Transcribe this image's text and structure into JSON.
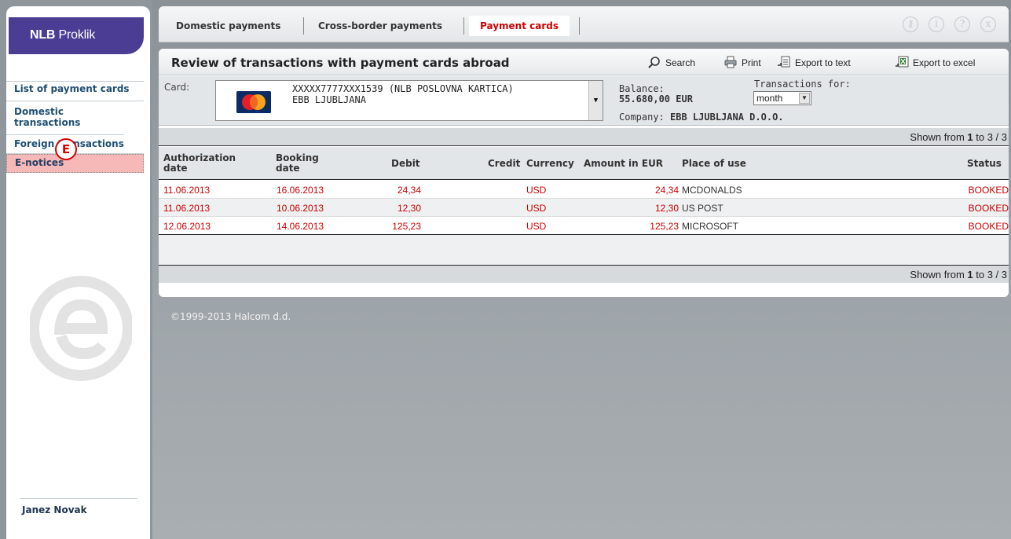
{
  "brand": {
    "name_1": "NLB",
    "name_2": "Proklik"
  },
  "sidebar": {
    "items": [
      {
        "label": "List of payment cards"
      },
      {
        "label": "Domestic transactions"
      },
      {
        "label": "Foreign transactions"
      },
      {
        "label": "E-notices"
      }
    ],
    "badge": "E",
    "user_name": "Janez Novak"
  },
  "tabs": [
    {
      "label": "Domestic payments"
    },
    {
      "label": "Cross-border payments"
    },
    {
      "label": "Payment cards",
      "active": true
    }
  ],
  "window_icons": [
    "key-icon",
    "info-icon",
    "help-icon",
    "close-icon"
  ],
  "panel": {
    "title": "Review of transactions with payment cards abroad",
    "actions": {
      "search": "Search",
      "print": "Print",
      "export_text": "Export to text",
      "export_excel": "Export to excel"
    }
  },
  "filter": {
    "card_label": "Card:",
    "card_line1": "XXXXX7777XXX1539 (NLB POSLOVNA KARTICA)",
    "card_line2": "EBB LJUBLJANA",
    "balance_label": "Balance:",
    "balance_value": "55.680,00 EUR",
    "company_label": "Company:",
    "company_value": "EBB LJUBLJANA D.O.O.",
    "transactions_for_label": "Transactions for:",
    "transactions_for_value": "month"
  },
  "paging": {
    "prefix": "Shown from ",
    "from": "1",
    "mid": " to 3 / 3"
  },
  "table": {
    "headers": {
      "auth_date": "Authorization date",
      "booking_date": "Booking date",
      "debit": "Debit",
      "credit": "Credit",
      "currency": "Currency",
      "amount_eur": "Amount in EUR",
      "place": "Place of use",
      "status": "Status"
    },
    "rows": [
      {
        "auth": "11.06.2013",
        "booking": "16.06.2013",
        "debit": "24,34",
        "credit": "",
        "currency": "USD",
        "amount": "24,34",
        "place": "MCDONALDS",
        "status": "BOOKED"
      },
      {
        "auth": "11.06.2013",
        "booking": "10.06.2013",
        "debit": "12,30",
        "credit": "",
        "currency": "USD",
        "amount": "12,30",
        "place": "US POST",
        "status": "BOOKED"
      },
      {
        "auth": "12.06.2013",
        "booking": "14.06.2013",
        "debit": "125,23",
        "credit": "",
        "currency": "USD",
        "amount": "125,23",
        "place": "MICROSOFT",
        "status": "BOOKED"
      }
    ]
  },
  "footer": "©1999-2013 Halcom d.d.",
  "colors": {
    "brand": "#4a3d93",
    "accent_red": "#cc0000",
    "enotices_bg": "#f7b8b8"
  }
}
